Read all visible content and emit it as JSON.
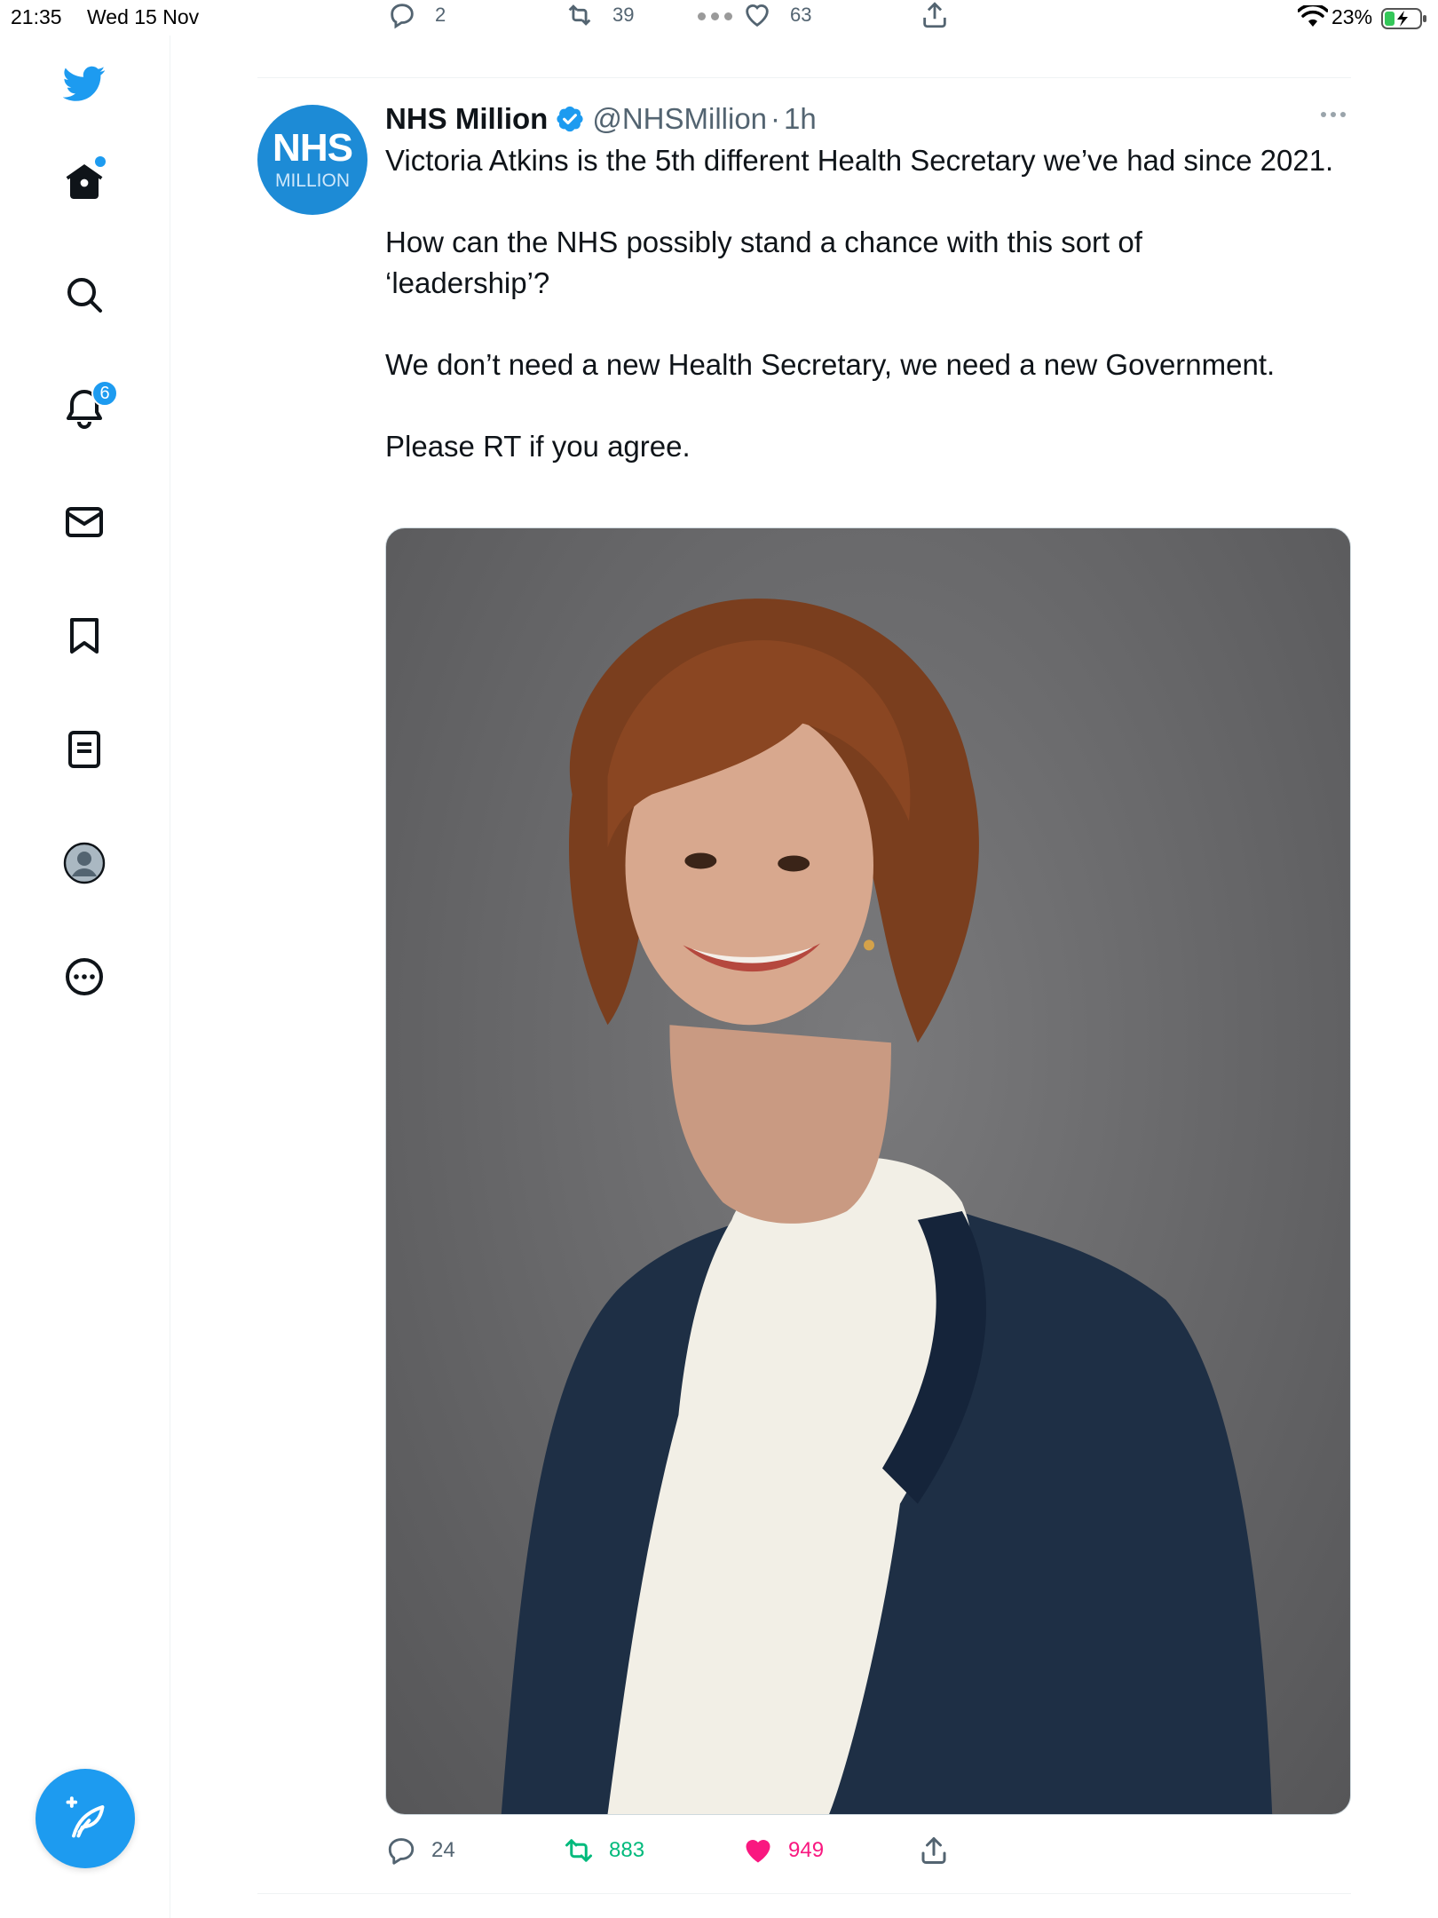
{
  "status_bar": {
    "time": "21:35",
    "date": "Wed 15 Nov",
    "battery_percent": "23%",
    "battery_icon": "battery-charging-icon",
    "wifi_icon": "wifi-icon"
  },
  "sidebar": {
    "items": [
      {
        "name": "twitter-logo",
        "icon": "bird-icon"
      },
      {
        "name": "home",
        "icon": "home-icon"
      },
      {
        "name": "explore",
        "icon": "search-icon"
      },
      {
        "name": "notifications",
        "icon": "bell-icon",
        "badge": "6"
      },
      {
        "name": "messages",
        "icon": "envelope-icon"
      },
      {
        "name": "bookmarks",
        "icon": "bookmark-icon"
      },
      {
        "name": "lists",
        "icon": "list-icon"
      },
      {
        "name": "profile",
        "icon": "avatar-icon"
      },
      {
        "name": "more",
        "icon": "more-circle-icon"
      }
    ],
    "compose_icon": "compose-feather-icon"
  },
  "previous_tweet": {
    "reply_count": "2",
    "retweet_count": "39",
    "like_count": "63"
  },
  "tweet": {
    "avatar": {
      "line1": "NHS",
      "line2": "MILLION"
    },
    "author_name": "NHS Million",
    "handle": "@NHSMillion",
    "separator": "·",
    "time": "1h",
    "paragraphs": [
      "Victoria Atkins is the 5th different Health Secretary we’ve had since 2021.",
      "How can the NHS possibly stand a chance with this sort of ‘leadership’?",
      "We don’t need a new Health Secretary, we need a new Government.",
      "Please RT if you agree."
    ],
    "reply_count": "24",
    "retweet_count": "883",
    "like_count": "949"
  },
  "colors": {
    "brand": "#1d9bf0",
    "retweet": "#00ba7c",
    "like": "#f91880",
    "secondary_text": "#536471"
  }
}
